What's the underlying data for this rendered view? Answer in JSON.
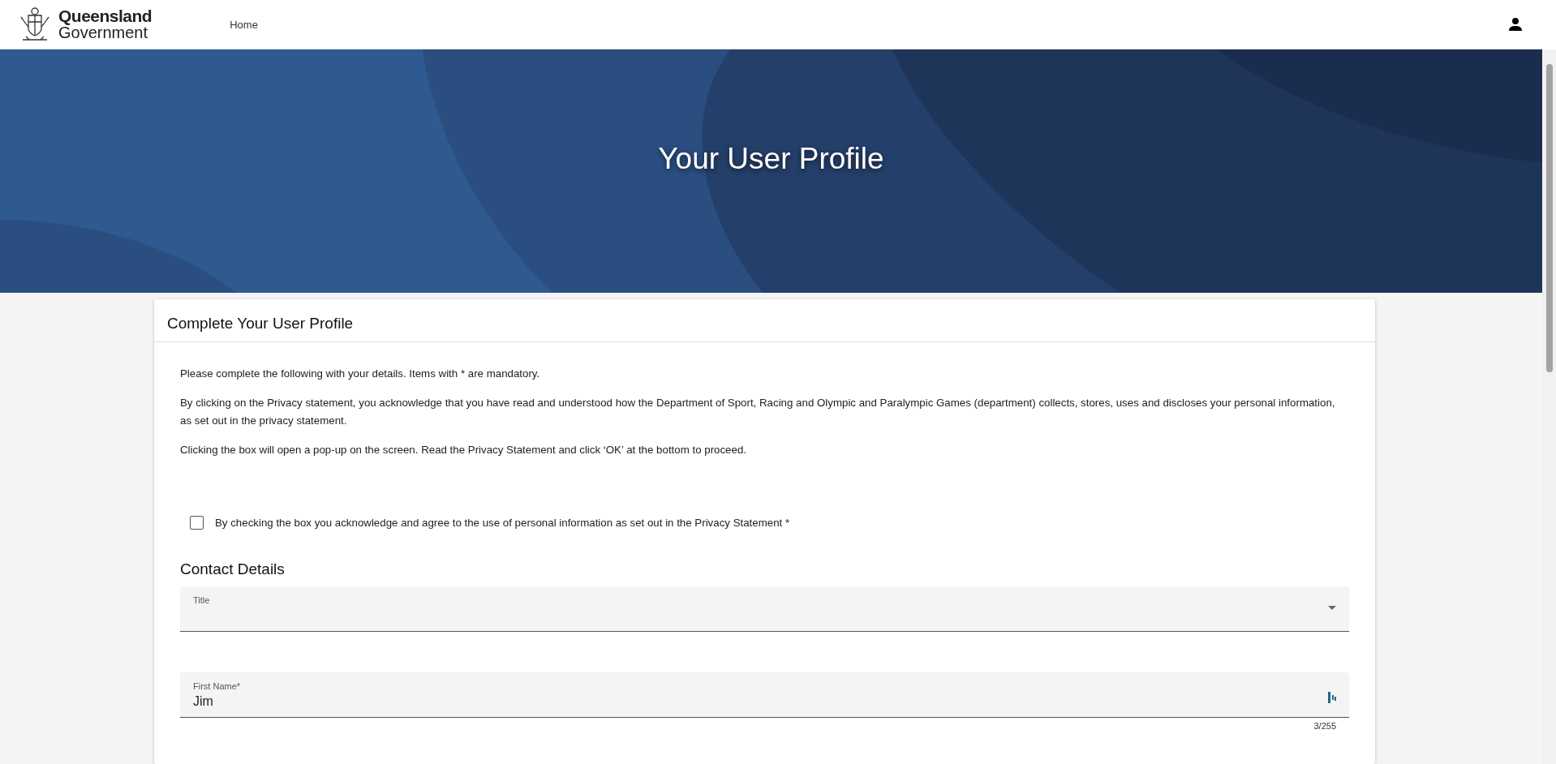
{
  "header": {
    "logo": {
      "line_1": "Queensland",
      "line_2": "Government"
    },
    "nav": [
      {
        "label": "Home"
      }
    ]
  },
  "hero": {
    "title": "Your User Profile"
  },
  "card": {
    "title": "Complete Your User Profile",
    "paragraphs": [
      "Please complete the following with your details. Items with * are mandatory.",
      "By clicking on the Privacy statement, you acknowledge that you have read and understood how the Department of Sport, Racing and Olympic and Paralympic Games (department) collects, stores, uses and discloses your personal information, as set out in the privacy statement.",
      "Clicking the box will open a pop-up on the screen. Read the Privacy Statement and click ‘OK’ at the bottom to proceed."
    ],
    "consent": {
      "label": "By checking the box you acknowledge and agree to the use of personal information as set out in the Privacy Statement *",
      "checked": false
    },
    "section_title": "Contact Details",
    "fields": [
      {
        "kind": "select",
        "label": "Title"
      },
      {
        "kind": "text",
        "label": "First Name*",
        "value": "Jim",
        "counter": "3/255"
      }
    ]
  }
}
